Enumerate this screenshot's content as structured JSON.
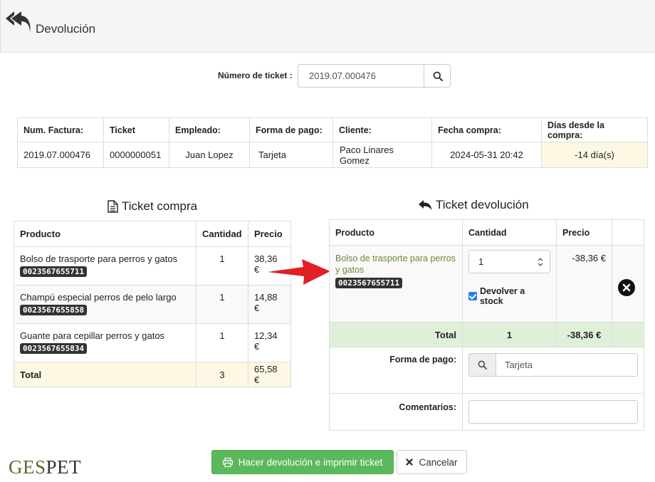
{
  "header": {
    "title": "Devolución",
    "back_icon": "reply-all-icon"
  },
  "search": {
    "label": "Número de ticket :",
    "value": "2019.07.000476",
    "icon": "search-icon"
  },
  "info": {
    "headers": [
      "Num. Factura:",
      "Ticket",
      "Empleado:",
      "Forma de pago:",
      "Cliente:",
      "Fecha compra:",
      "Días desde la compra:"
    ],
    "values": [
      "2019.07.000476",
      "0000000051",
      "Juan Lopez",
      "Tarjeta",
      "Paco Linares Gomez",
      "2024-05-31 20:42",
      "-14 día(s)"
    ]
  },
  "ticket_compra": {
    "title": "Ticket compra",
    "headers": [
      "Producto",
      "Cantidad",
      "Precio"
    ],
    "rows": [
      {
        "name": "Bolso de trasporte para perros y gatos",
        "code": "0023567655711",
        "qty": "1",
        "price": "38,36 €"
      },
      {
        "name": "Champú especial perros de pelo largo",
        "code": "0023567655858",
        "qty": "1",
        "price": "14,88 €"
      },
      {
        "name": "Guante para cepillar perros y gatos",
        "code": "0023567655834",
        "qty": "1",
        "price": "12,34 €"
      }
    ],
    "total": {
      "label": "Total",
      "qty": "3",
      "price": "65,58 €"
    }
  },
  "ticket_devolucion": {
    "title": "Ticket devolución",
    "headers": [
      "Producto",
      "Cantidad",
      "Precio"
    ],
    "item": {
      "name": "Bolso de trasporte para perros y gatos",
      "code": "0023567655711",
      "qty": "1",
      "price": "-38,36 €",
      "stock_label": "Devolver a stock",
      "stock_checked": true
    },
    "total": {
      "label": "Total",
      "qty": "1",
      "price": "-38,36 €"
    },
    "payment": {
      "label": "Forma de pago:",
      "value": "Tarjeta"
    },
    "comments": {
      "label": "Comentarios:",
      "value": ""
    }
  },
  "footer": {
    "logo_a": "GES",
    "logo_b": "PET",
    "submit_label": "Hacer devolución e imprimir ticket",
    "cancel_label": "Cancelar"
  },
  "colors": {
    "accent_green": "#5cb85c",
    "arrow_red": "#e01f26",
    "product_green": "#6b8a3a",
    "warning_bg": "#fcf8e3",
    "success_bg": "#dff0d8"
  }
}
